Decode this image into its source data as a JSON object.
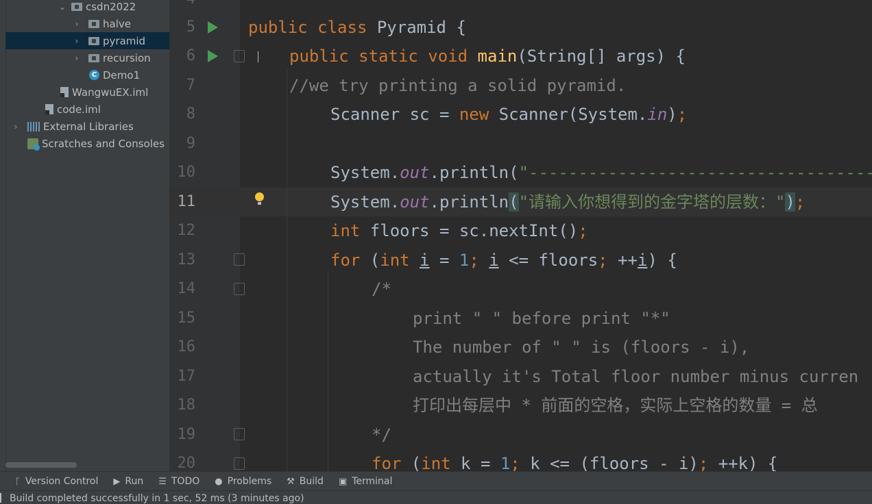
{
  "project_tree": {
    "items": [
      {
        "label": "csdn2022",
        "kind": "folder",
        "expanded": true,
        "chevron": "⌄"
      },
      {
        "label": "halve",
        "kind": "package",
        "chevron": "›"
      },
      {
        "label": "pyramid",
        "kind": "package",
        "chevron": "›",
        "selected": true
      },
      {
        "label": "recursion",
        "kind": "package",
        "chevron": "›"
      },
      {
        "label": "Demo1",
        "kind": "class",
        "icon_letter": "C"
      },
      {
        "label": "WangwuEX.iml",
        "kind": "file"
      },
      {
        "label": "code.iml",
        "kind": "file"
      },
      {
        "label": "External Libraries",
        "kind": "library",
        "chevron": "›"
      },
      {
        "label": "Scratches and Consoles",
        "kind": "scratch"
      }
    ]
  },
  "editor": {
    "line_numbers": [
      "4",
      "5",
      "6",
      "7",
      "8",
      "9",
      "10",
      "11",
      "12",
      "13",
      "14",
      "15",
      "16",
      "17",
      "18",
      "19",
      "20"
    ],
    "current_line": "11",
    "code": {
      "l5_kw": "public class ",
      "l5_rest": "Pyramid {",
      "l6_kw": "public static void ",
      "l6_fn": "main",
      "l6_rest": "(String[] args) {",
      "l7": "//we try printing a solid pyramid.",
      "l8_a": "Scanner sc = ",
      "l8_kw": "new ",
      "l8_b": "Scanner(System.",
      "l8_static": "in",
      "l8_c": ")",
      "l8_semi": ";",
      "l10_a": "System.",
      "l10_static": "out",
      "l10_b": ".println(",
      "l10_str": "\"------------------------------------",
      "l11_a": "System.",
      "l11_static": "out",
      "l11_b": ".println",
      "l11_paren": "(",
      "l11_str": "\"请输入你想得到的金字塔的层数：\"",
      "l11_paren2": ")",
      "l11_semi": ";",
      "l12_kw": "int ",
      "l12_rest": "floors = sc.nextInt()",
      "l12_semi": ";",
      "l13_kw": "for ",
      "l13_a": "(",
      "l13_kw2": "int ",
      "l13_i1": "i",
      "l13_b": " = ",
      "l13_num": "1",
      "l13_semi1": "; ",
      "l13_i2": "i",
      "l13_c": " <= floors",
      "l13_semi2": "; ",
      "l13_d": "++",
      "l13_i3": "i",
      "l13_e": ") {",
      "l14": "/*",
      "l15": "print \" \" before print \"*\"",
      "l16": "The number of \" \" is (floors - i),",
      "l17": "actually it's Total floor number minus curren",
      "l18": "打印出每层中 * 前面的空格，实际上空格的数量 = 总",
      "l19": "*/",
      "l20_kw": "for ",
      "l20_a": "(",
      "l20_kw2": "int ",
      "l20_b": "k = ",
      "l20_num": "1",
      "l20_semi1": "; ",
      "l20_c": "k <= (floors - i)",
      "l20_semi2": "; ",
      "l20_d": "++k) {"
    }
  },
  "tool_windows": {
    "version_control": "Version Control",
    "run": "Run",
    "todo": "TODO",
    "problems": "Problems",
    "build": "Build",
    "terminal": "Terminal"
  },
  "status_bar": {
    "message": "Build completed successfully in 1 sec, 52 ms (3 minutes ago)"
  },
  "colors": {
    "keyword": "#cc7832",
    "function": "#ffc66d",
    "string": "#6a8759",
    "comment": "#808080",
    "number": "#6897bb",
    "static_field": "#9876aa",
    "run_gutter": "#499c54"
  }
}
